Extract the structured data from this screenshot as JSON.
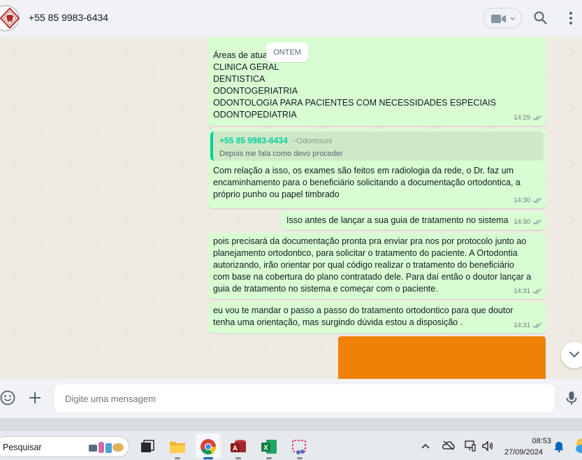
{
  "header": {
    "contact_name": "+55 85 9983-6434",
    "icons": [
      "avatar-logo",
      "video-call-icon",
      "chevron-down-icon",
      "search-icon",
      "menu-dots-icon"
    ]
  },
  "chat": {
    "date_separator": "ONTEM",
    "messages": [
      {
        "text": "Áreas de atua\nCLINICA GERAL\nDENTISTICA\nODONTOGERIATRIA\nODONTOLOGIA PARA PACIENTES COM NECESSIDADES ESPECIAIS\nODONTOPEDIATRIA",
        "time": "14:29",
        "status": "read"
      },
      {
        "quote": {
          "author": "+55 85 9983-6434",
          "alias": "~Odontouni",
          "text": "Depois me fala como devo proceder"
        },
        "text": "Com relação a isso, os exames são feitos em radiologia da rede, o Dr. faz um\nencaminhamento para o beneficiário solicitando a documentação ortodontica, a\npróprio punho ou papel timbrado",
        "time": "14:30",
        "status": "read"
      },
      {
        "text": "Isso antes de lançar a sua guia de tratamento no sistema",
        "time": "14:30",
        "status": "read"
      },
      {
        "text": "pois precisará da documentação pronta pra enviar pra nos por protocolo junto ao\nplanejamento ortodontico, para solicitar o tratamento do paciente. A Ortodontia\nautorizando, irão orientar por qual código realizar o tratamento do beneficiário\ncom base na cobertura do plano contratado dele. Para daí então o doutor lançar a\nguia de tratamento no sistema e começar com o paciente.",
        "time": "14:31",
        "status": "read"
      },
      {
        "text": "eu vou te mandar o passo a passo do tratamento ortodontico para que doutor\ntenha uma orientação, mas surgindo dúvida estou a disposição .",
        "time": "14:31",
        "status": "read"
      }
    ],
    "media_color": "#f08108"
  },
  "composer": {
    "placeholder": "Digite uma mensagem",
    "value": "",
    "icons": [
      "emoji-icon",
      "plus-icon",
      "mic-icon"
    ]
  },
  "taskbar": {
    "search_label": "Pesquisar",
    "apps": [
      "task-view-icon",
      "file-explorer-icon",
      "chrome-icon",
      "access-icon",
      "excel-icon",
      "snipping-tool-icon"
    ],
    "active_app": "chrome-icon",
    "tray_icons": [
      "chevron-up-icon",
      "cloud-offline-icon",
      "display-icon",
      "volume-icon",
      "notification-icon",
      "weather-icon"
    ],
    "clock": {
      "time": "08:53",
      "date": "27/09/2024"
    }
  },
  "colors": {
    "outgoing_bubble": "#d9fdd3",
    "chat_background": "#efeae2",
    "quote_accent": "#06cf9c",
    "header_background": "#f0f2f5"
  }
}
